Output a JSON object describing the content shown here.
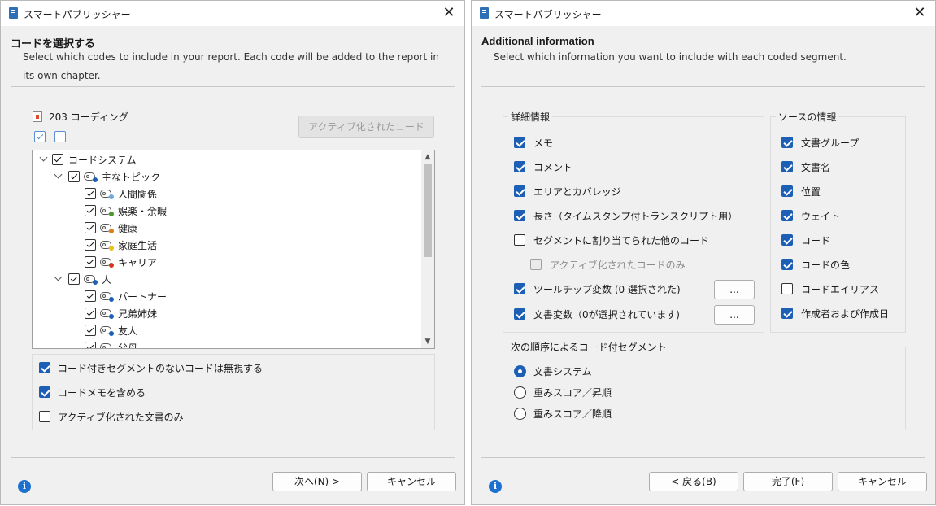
{
  "left_dialog": {
    "window_title": "スマートパブリッシャー",
    "heading": "コードを選択する",
    "description": "Select which codes to include in your report. Each code will be added to the report in its own chapter.",
    "coding_count": "203 コーディング",
    "activated_codes_button": "アクティブ化されたコード",
    "tree": {
      "root": "コードシステム",
      "groups": [
        {
          "label": "主なトピック",
          "color": "#1d5fb5",
          "children": [
            {
              "label": "人間関係",
              "color": "#6aa8e0"
            },
            {
              "label": "娯楽・余暇",
              "color": "#4c9a2a"
            },
            {
              "label": "健康",
              "color": "#e07a1a"
            },
            {
              "label": "家庭生活",
              "color": "#e8c21a"
            },
            {
              "label": "キャリア",
              "color": "#d8321a"
            }
          ]
        },
        {
          "label": "人",
          "color": "#1d5fb5",
          "children": [
            {
              "label": "パートナー",
              "color": "#1d5fb5"
            },
            {
              "label": "兄弟姉妹",
              "color": "#1d5fb5"
            },
            {
              "label": "友人",
              "color": "#1d5fb5"
            },
            {
              "label": "父母",
              "color": "#1d5fb5"
            }
          ]
        }
      ]
    },
    "options": [
      {
        "label": "コード付きセグメントのないコードは無視する",
        "checked": true
      },
      {
        "label": "コードメモを含める",
        "checked": true
      },
      {
        "label": "アクティブ化された文書のみ",
        "checked": false
      }
    ],
    "next_button": "次へ(N) >",
    "cancel_button": "キャンセル"
  },
  "right_dialog": {
    "window_title": "スマートパブリッシャー",
    "heading": "Additional information",
    "description": "Select which information you want to include with each coded segment.",
    "details_group": {
      "title": "詳細情報",
      "items": [
        {
          "label": "メモ",
          "checked": true
        },
        {
          "label": "コメント",
          "checked": true
        },
        {
          "label": "エリアとカバレッジ",
          "checked": true
        },
        {
          "label": "長さ（タイムスタンプ付トランスクリプト用）",
          "checked": true
        },
        {
          "label": "セグメントに割り当てられた他のコード",
          "checked": false
        },
        {
          "label": "アクティブ化されたコードのみ",
          "checked": false,
          "disabled": true
        },
        {
          "label": "ツールチップ変数 (0 選択された)",
          "checked": true
        },
        {
          "label": "文書変数（0が選択されています)",
          "checked": true
        }
      ],
      "ellipsis_button": "..."
    },
    "source_group": {
      "title": "ソースの情報",
      "items": [
        {
          "label": "文書グループ",
          "checked": true
        },
        {
          "label": "文書名",
          "checked": true
        },
        {
          "label": "位置",
          "checked": true
        },
        {
          "label": "ウェイト",
          "checked": true
        },
        {
          "label": "コード",
          "checked": true
        },
        {
          "label": "コードの色",
          "checked": true
        },
        {
          "label": "コードエイリアス",
          "checked": false
        },
        {
          "label": "作成者および作成日",
          "checked": true
        }
      ]
    },
    "order_group": {
      "title": "次の順序によるコード付セグメント",
      "options": [
        {
          "label": "文書システム",
          "selected": true
        },
        {
          "label": "重みスコア／昇順",
          "selected": false
        },
        {
          "label": "重みスコア／降順",
          "selected": false
        }
      ]
    },
    "back_button": "< 戻る(B)",
    "finish_button": "完了(F)",
    "cancel_button": "キャンセル"
  },
  "colors": {
    "accent": "#1d5fb5",
    "info": "#1d6fd0"
  }
}
